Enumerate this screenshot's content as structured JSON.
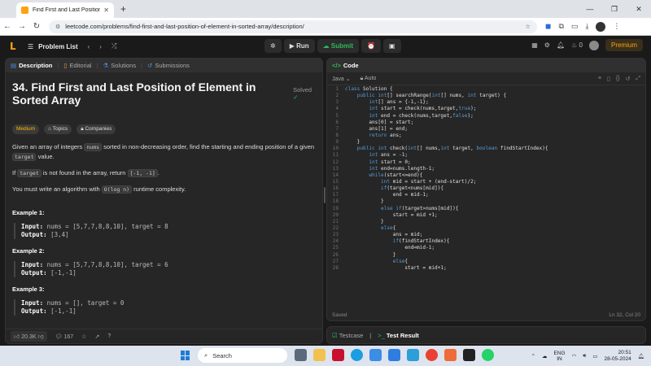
{
  "browser": {
    "tab_title": "Find First and Last Position of E",
    "new_tab": "+",
    "url": "leetcode.com/problems/find-first-and-last-position-of-element-in-sorted-array/description/"
  },
  "header": {
    "problem_list": "Problem List",
    "run": "Run",
    "submit": "Submit",
    "streak_count": "0",
    "premium": "Premium"
  },
  "left_panel": {
    "tabs": [
      "Description",
      "Editorial",
      "Solutions",
      "Submissions"
    ],
    "title": "34. Find First and Last Position of Element in Sorted Array",
    "solved": "Solved",
    "tags": [
      "Medium",
      "Topics",
      "Companies"
    ],
    "desc": {
      "p1_a": "Given an array of integers ",
      "p1_code1": "nums",
      "p1_b": " sorted in non-decreasing order, find the starting and ending position of a given ",
      "p1_code2": "target",
      "p1_c": " value.",
      "p2_a": "If ",
      "p2_code1": "target",
      "p2_b": " is not found in the array, return ",
      "p2_code2": "[-1, -1]",
      "p2_c": ".",
      "p3_a": "You must write an algorithm with ",
      "p3_code": "O(log n)",
      "p3_b": " runtime complexity."
    },
    "examples": [
      {
        "heading": "Example 1:",
        "input_label": "Input:",
        "input": " nums = [5,7,7,8,8,10], target = 8",
        "output_label": "Output:",
        "output": " [3,4]"
      },
      {
        "heading": "Example 2:",
        "input_label": "Input:",
        "input": " nums = [5,7,7,8,8,10], target = 6",
        "output_label": "Output:",
        "output": " [-1,-1]"
      },
      {
        "heading": "Example 3:",
        "input_label": "Input:",
        "input": " nums = [], target = 0",
        "output_label": "Output:",
        "output": " [-1,-1]"
      }
    ],
    "footer": {
      "likes": "20.3K",
      "comments": "167"
    }
  },
  "code_panel": {
    "title": "Code",
    "language": "Java",
    "mode": "Auto",
    "status": "Saved",
    "cursor": "Ln 32, Col 20",
    "lines": [
      "class Solution {",
      "    public int[] searchRange(int[] nums, int target) {",
      "        int[] ans = {-1,-1};",
      "        int start = check(nums,target,true);",
      "        int end = check(nums,target,false);",
      "        ans[0] = start;",
      "        ans[1] = end;",
      "        return ans;",
      "    }",
      "    public int check(int[] nums,int target, boolean findStartIndex){",
      "        int ans = -1;",
      "        int start = 0;",
      "        int end=nums.length-1;",
      "        while(start<=end){",
      "            int mid = start + (end-start)/2;",
      "            if(target<nums[mid]){",
      "                end = mid-1;",
      "            }",
      "            else if(target>nums[mid]){",
      "                start = mid +1;",
      "            }",
      "            else{",
      "                ans = mid;",
      "                if(findStartIndex){",
      "                    end=mid-1;",
      "                }",
      "                else{",
      "                    start = mid+1;"
    ]
  },
  "test_panel": {
    "testcase": "Testcase",
    "result": "Test Result"
  },
  "taskbar": {
    "search": "Search",
    "lang1": "ENG",
    "lang2": "IN",
    "time": "20:51",
    "date": "28-05-2024"
  }
}
